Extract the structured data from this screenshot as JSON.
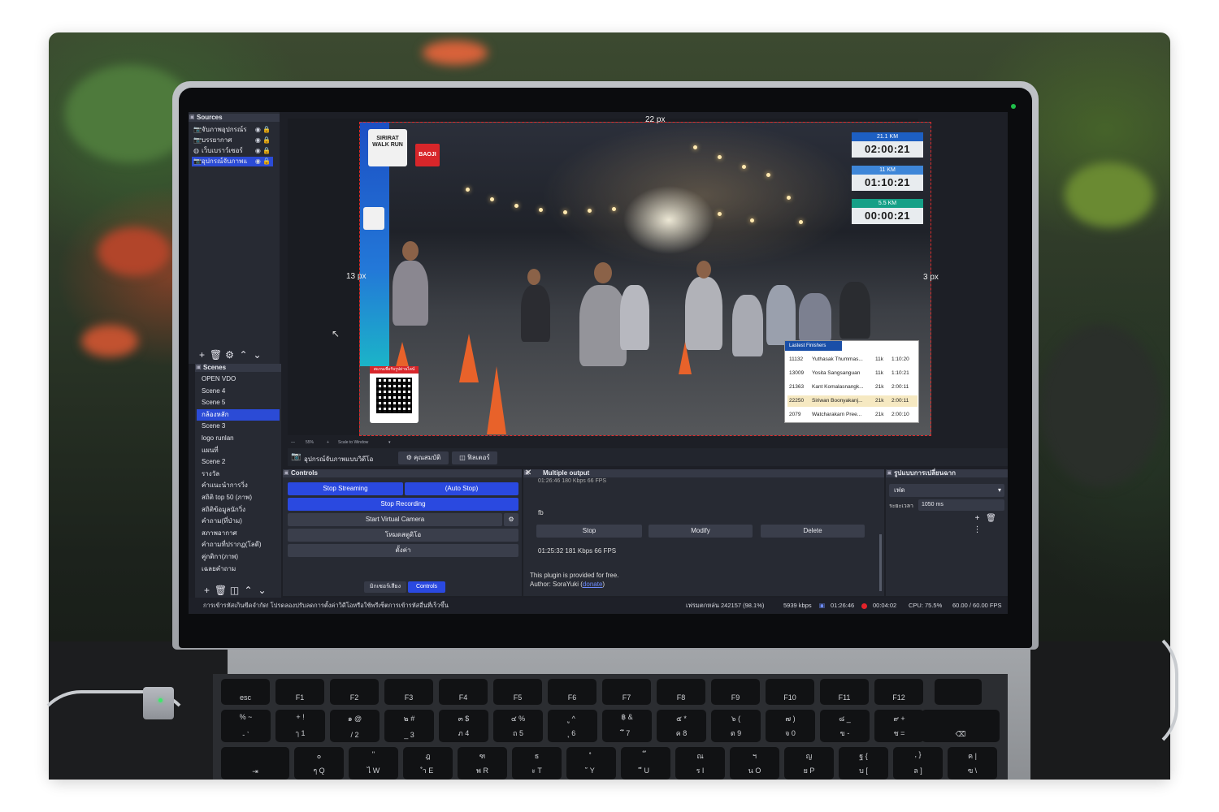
{
  "sources": {
    "title": "Sources",
    "items": [
      {
        "label": "จับภาพอุปกรณ์ร",
        "icon": "camera-icon",
        "selected": false
      },
      {
        "label": "บรรยากาศ",
        "icon": "camera-icon",
        "selected": false
      },
      {
        "label": "เว็บเบราว์เซอร์",
        "icon": "globe-icon",
        "selected": false
      },
      {
        "label": "อุปกรณ์จับภาพแ",
        "icon": "camera-icon",
        "selected": true
      }
    ]
  },
  "scenes": {
    "title": "Scenes",
    "items": [
      {
        "label": "OPEN VDO",
        "selected": false
      },
      {
        "label": "Scene 4",
        "selected": false
      },
      {
        "label": "Scene 5",
        "selected": false
      },
      {
        "label": "กล้องหลัก",
        "selected": true
      },
      {
        "label": "Scene 3",
        "selected": false
      },
      {
        "label": "logo runlan",
        "selected": false
      },
      {
        "label": "แผนที่",
        "selected": false
      },
      {
        "label": "Scene 2",
        "selected": false
      },
      {
        "label": "รางวัล",
        "selected": false
      },
      {
        "label": "คำแนะนำการวิ่ง",
        "selected": false
      },
      {
        "label": "สถิติ top 50 (ภาพ)",
        "selected": false
      },
      {
        "label": "สถิติข้อมูลนักวิ่ง",
        "selected": false
      },
      {
        "label": "คำถาม(ที่ป่าม)",
        "selected": false
      },
      {
        "label": "สภาพอากาศ",
        "selected": false
      },
      {
        "label": "คำถามที่ปรากฏ(โลดี)",
        "selected": false
      },
      {
        "label": "คู่กติกา(ภาพ)",
        "selected": false
      },
      {
        "label": "เฉลยคำถาม",
        "selected": false
      }
    ]
  },
  "preview": {
    "top_px": "22 px",
    "left_px": "13 px",
    "right_px": "3 px",
    "zoom": "55%",
    "scale_mode": "Scale to Window",
    "event_logo": "SIRIRAT WALK RUN",
    "sponsor": "BAOJI",
    "qr_caption": "สแกนเพื่อรับรูปผ่านไลน์",
    "timers": [
      {
        "distance": "21.1 KM",
        "time": "02:00:21",
        "color": "#1d5fc2"
      },
      {
        "distance": "11 KM",
        "time": "01:10:21",
        "color": "#3e86d8"
      },
      {
        "distance": "5.5 KM",
        "time": "00:00:21",
        "color": "#16a087"
      }
    ],
    "finishers": {
      "title": "Lastest Finishers",
      "rows": [
        {
          "bib": "11132",
          "name": "Yuthasak Thummas...",
          "dist": "11k",
          "time": "1:10:20",
          "highlight": false
        },
        {
          "bib": "13009",
          "name": "Yosita Sangsanguan",
          "dist": "11k",
          "time": "1:10:21",
          "highlight": false
        },
        {
          "bib": "21363",
          "name": "Kant Komalasnangk...",
          "dist": "21k",
          "time": "2:00:11",
          "highlight": false
        },
        {
          "bib": "22250",
          "name": "Siriwan Boonyakanj...",
          "dist": "21k",
          "time": "2:00:11",
          "highlight": true
        },
        {
          "bib": "2079",
          "name": "Watcharakarn Pree...",
          "dist": "21k",
          "time": "2:00:10",
          "highlight": false
        }
      ]
    }
  },
  "source_bar": {
    "selected_source": "อุปกรณ์จับภาพแบบวิดีโอ",
    "properties_label": "คุณสมบัติ",
    "filters_label": "ฟิลเตอร์"
  },
  "controls": {
    "title": "Controls",
    "stop_streaming": "Stop Streaming",
    "auto_stop": "(Auto Stop)",
    "stop_recording": "Stop Recording",
    "start_virtual_camera": "Start Virtual Camera",
    "studio_mode": "โหมดสตูดิโอ",
    "settings": "ตั้งค่า",
    "tab_audio_mixer": "มิกเซอร์เสียง",
    "tab_controls": "Controls"
  },
  "multiple_output": {
    "title": "Multiple output",
    "scrolled_line": "01:26:46  180 Kbps  66 FPS",
    "target_name": "fb",
    "stop_label": "Stop",
    "modify_label": "Modify",
    "delete_label": "Delete",
    "stats": "01:25:32  181 Kbps  66 FPS",
    "free_note": "This plugin is provided for free.",
    "author_prefix": "Author: SoraYuki (",
    "donate_label": "donate",
    "author_suffix": ")"
  },
  "transitions": {
    "title": "รูปแบบการเปลี่ยนฉาก",
    "selected": "เฟด",
    "duration_label": "ระยะเวลา",
    "duration_value": "1050 ms"
  },
  "status": {
    "message": "การเข้ารหัสเกินขีดจำกัด! โปรดลองปรับลดการตั้งค่าวิดีโอหรือใช้พรีเซ็ตการเข้ารหัสอื่นที่เร็วขึ้น",
    "dropped": "เฟรมตกหล่น 242157 (98.1%)",
    "bitrate": "5939 kbps",
    "stream_time": "01:26:46",
    "rec_time": "00:04:02",
    "cpu": "CPU: 75.5%",
    "fps": "60.00 / 60.00 FPS"
  },
  "keyboard": {
    "fn_row": [
      "esc",
      "F1",
      "F2",
      "F3",
      "F4",
      "F5",
      "F6",
      "F7",
      "F8",
      "F9",
      "F10",
      "F11",
      "F12"
    ],
    "num_row": [
      {
        "top": "%  ~",
        "main": "-  `"
      },
      {
        "top": "+  !",
        "main": "ๅ  1"
      },
      {
        "top": "๑  @",
        "main": "/  2"
      },
      {
        "top": "๒  #",
        "main": "_  3"
      },
      {
        "top": "๓  $",
        "main": "ภ  4"
      },
      {
        "top": "๔  %",
        "main": "ถ  5"
      },
      {
        "top": "ู  ^",
        "main": "ุ  6"
      },
      {
        "top": "฿  &",
        "main": "ึ  7"
      },
      {
        "top": "๕  *",
        "main": "ค  8"
      },
      {
        "top": "๖  (",
        "main": "ต  9"
      },
      {
        "top": "๗  )",
        "main": "จ  0"
      },
      {
        "top": "๘  _",
        "main": "ข  -"
      },
      {
        "top": "๙  +",
        "main": "ช  ="
      }
    ],
    "q_row": [
      {
        "top": "๐",
        "main": "ๆ  Q"
      },
      {
        "top": "\"",
        "main": "ไ  W"
      },
      {
        "top": "ฎ",
        "main": "ำ  E"
      },
      {
        "top": "ฑ",
        "main": "พ  R"
      },
      {
        "top": "ธ",
        "main": "ะ  T"
      },
      {
        "top": "ํ",
        "main": "ั  Y"
      },
      {
        "top": "๊",
        "main": "ี  U"
      },
      {
        "top": "ณ",
        "main": "ร  I"
      },
      {
        "top": "ฯ",
        "main": "น  O"
      },
      {
        "top": "ญ",
        "main": "ย  P"
      },
      {
        "top": "ฐ  {",
        "main": "บ  ["
      },
      {
        "top": ",  }",
        "main": "ล  ]"
      },
      {
        "top": "ฅ  |",
        "main": "ฃ  \\"
      }
    ],
    "tab_glyph": "⇥",
    "delete_glyph": "⌫"
  }
}
